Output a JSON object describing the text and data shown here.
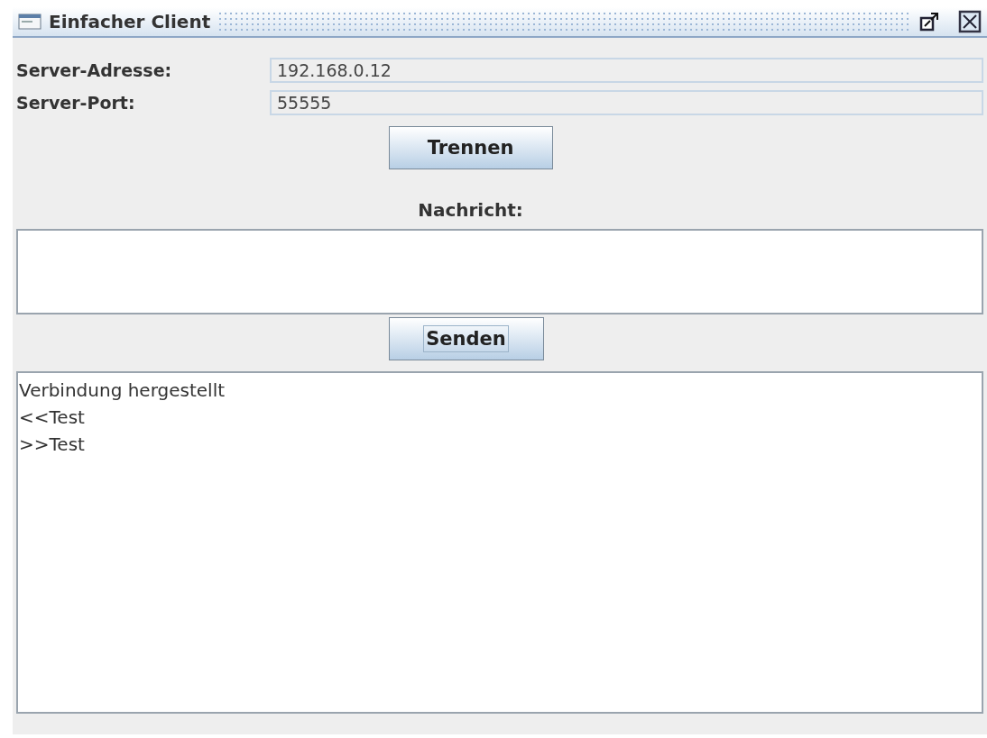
{
  "window": {
    "title": "Einfacher Client"
  },
  "fields": [
    {
      "label": "Server-Adresse:",
      "value": "192.168.0.12",
      "disabled": true
    },
    {
      "label": "Server-Port:",
      "value": "55555",
      "disabled": true
    }
  ],
  "connect_button": {
    "label": "Trennen",
    "focused": false
  },
  "message": {
    "label": "Nachricht:"
  },
  "send_button": {
    "label": "Senden",
    "focused": true
  },
  "log": {
    "lines": [
      "Verbindung hergestellt",
      "<<Test",
      ">>Test"
    ]
  }
}
